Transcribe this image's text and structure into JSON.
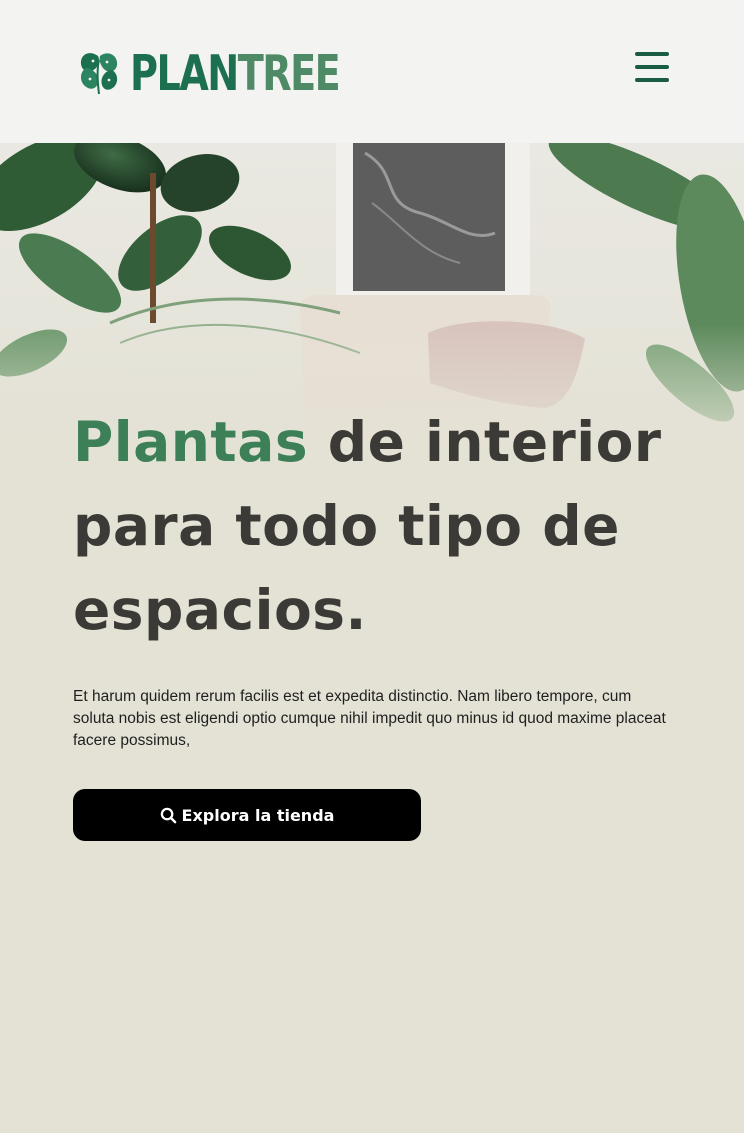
{
  "header": {
    "logo": {
      "icon": "leaf-logo-icon",
      "text_part1": "PLAN",
      "text_part2": "TREE"
    },
    "menu_icon": "hamburger-menu-icon"
  },
  "hero": {
    "headline_accent": "Plantas",
    "headline_rest": " de interior para todo tipo de espacios.",
    "description": "Et harum quidem rerum facilis est et expedita distinctio. Nam libero tempore, cum soluta nobis est eligendi optio cumque nihil impedit quo minus id quod maxime placeat facere possimus,",
    "cta": {
      "icon": "search-icon",
      "label": "Explora la tienda"
    }
  },
  "colors": {
    "background": "#e4e2d5",
    "header_background": "#f3f3f1",
    "brand_dark_green": "#1c7050",
    "brand_light_green": "#4f8a66",
    "accent_green": "#3d8058",
    "headline_text": "#3c3a37",
    "button_background": "#000000",
    "button_text": "#ffffff"
  }
}
